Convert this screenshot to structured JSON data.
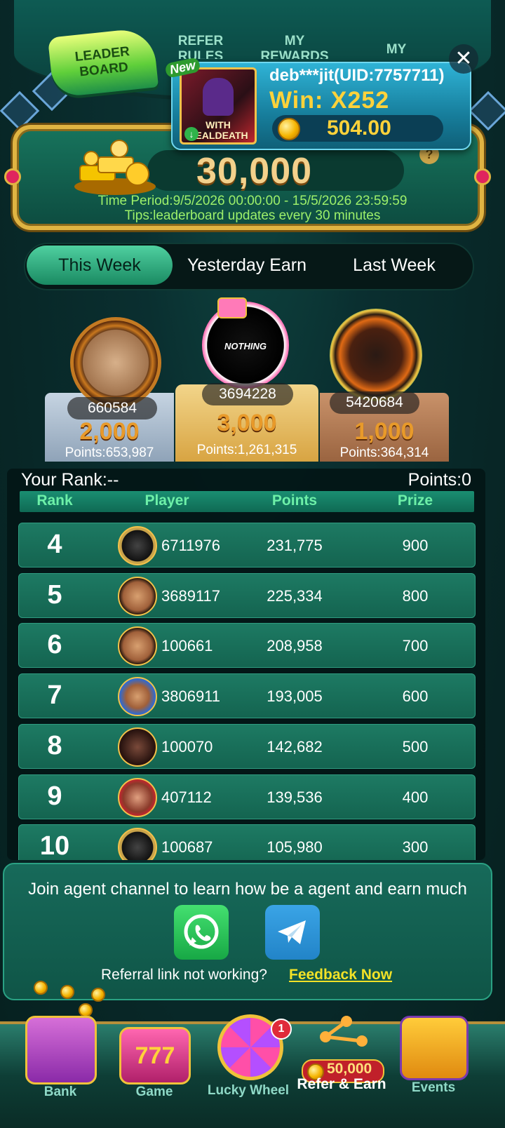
{
  "top_tabs": {
    "leader": "LEADER\nBOARD",
    "refer": "REFER\nRULES",
    "my_rewards": "MY\nREWARDS",
    "my": "MY"
  },
  "win_popup": {
    "badge": "New",
    "game_title": "WITH\nDEALDEATH",
    "user": "deb***jit(UID:7757711)",
    "win_label": "Win: X252",
    "amount": "504.00"
  },
  "prize_pool": {
    "value": "30,000",
    "period": "Time Period:9/5/2026 00:00:00 - 15/5/2026 23:59:59",
    "tips": "Tips:leaderboard updates every 30 minutes"
  },
  "period_tabs": [
    "This Week",
    "Yesterday Earn",
    "Last Week"
  ],
  "podium": [
    {
      "id": "660584",
      "prize": "2,000",
      "points": "Points:653,987"
    },
    {
      "id": "3694228",
      "prize": "3,000",
      "points": "Points:1,261,315",
      "avatar_text": "NOTHING"
    },
    {
      "id": "5420684",
      "prize": "1,000",
      "points": "Points:364,314"
    }
  ],
  "your_rank": {
    "rank": "Your Rank:--",
    "points": "Points:0"
  },
  "table_headers": [
    "Rank",
    "Player",
    "Points",
    "Prize"
  ],
  "rows": [
    {
      "rank": "4",
      "player": "6711976",
      "points": "231,775",
      "prize": "900"
    },
    {
      "rank": "5",
      "player": "3689117",
      "points": "225,334",
      "prize": "800"
    },
    {
      "rank": "6",
      "player": "100661",
      "points": "208,958",
      "prize": "700"
    },
    {
      "rank": "7",
      "player": "3806911",
      "points": "193,005",
      "prize": "600"
    },
    {
      "rank": "8",
      "player": "100070",
      "points": "142,682",
      "prize": "500"
    },
    {
      "rank": "9",
      "player": "407112",
      "points": "139,536",
      "prize": "400"
    },
    {
      "rank": "10",
      "player": "100687",
      "points": "105,980",
      "prize": "300"
    }
  ],
  "join": {
    "text": "Join agent channel to learn how be a agent and earn much",
    "referral": "Referral link not working?",
    "feedback": "Feedback Now"
  },
  "nav": {
    "bank": "Bank",
    "game": "Game",
    "lucky_wheel": "Lucky Wheel",
    "refer": "Refer & Earn",
    "events": "Events",
    "wheel_badge": "1",
    "refer_amount": "50,000"
  },
  "colors": {
    "accent_green": "#1d7a63",
    "gold": "#e0b442",
    "win_yellow": "#ffd23a"
  }
}
